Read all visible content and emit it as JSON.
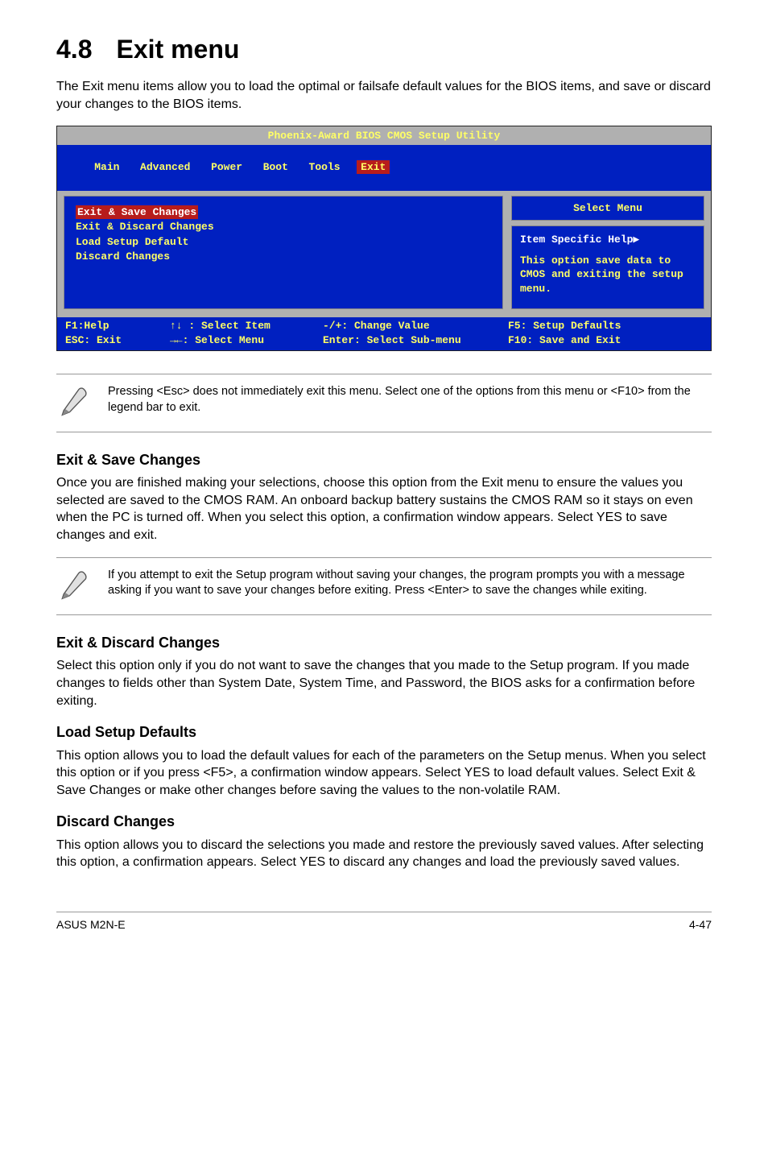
{
  "title_num": "4.8",
  "title_text": "Exit menu",
  "intro": "The Exit menu items allow you to load the optimal or failsafe default values for the BIOS items, and save or discard your changes to the BIOS items.",
  "bios": {
    "top": "Phoenix-Award BIOS CMOS Setup Utility",
    "tabs": [
      "Main",
      "Advanced",
      "Power",
      "Boot",
      "Tools",
      "Exit"
    ],
    "tabs_selected_index": 5,
    "items": [
      "Exit & Save Changes",
      "Exit & Discard Changes",
      "Load Setup Default",
      "Discard Changes"
    ],
    "highlight_index": 0,
    "right_title": "Select Menu",
    "help_label": "Item Specific Help▶",
    "help_body": "This option save data to CMOS and exiting the setup menu.",
    "foot_f1": "F1:Help",
    "foot_esc": "ESC: Exit",
    "foot_selitem": "↑↓ : Select Item",
    "foot_selmenu": "→←: Select Menu",
    "foot_change": "-/+: Change Value",
    "foot_enter": "Enter: Select Sub-menu",
    "foot_f5": "F5: Setup Defaults",
    "foot_f10": "F10: Save and Exit"
  },
  "note1": "Pressing <Esc> does not immediately exit this menu. Select one of the options from this menu or <F10> from the legend bar to exit.",
  "sections": {
    "esc_title": "Exit & Save Changes",
    "esc_body": "Once you are finished making your selections, choose this option from the Exit menu to ensure the values you selected are saved to the CMOS RAM. An onboard backup battery sustains the CMOS RAM so it stays on even when the PC is turned off. When you select this option, a confirmation window appears. Select YES to save changes and exit.",
    "note2": " If you attempt to exit the Setup program without saving your changes, the program prompts you with a message asking if you want to save your changes before exiting. Press <Enter>  to save the  changes while exiting.",
    "edc_title": "Exit & Discard Changes",
    "edc_body": "Select this option only if you do not want to save the changes that you  made to the Setup program. If you made changes to fields other than System Date, System Time, and Password, the BIOS asks for a confirmation before exiting.",
    "lsd_title": "Load Setup Defaults",
    "lsd_body": "This option allows you to load the default values for each of the parameters on the Setup menus. When you select this option or if you press <F5>, a confirmation window appears. Select YES to load default values. Select Exit & Save Changes or make other changes before saving the values to the non-volatile RAM.",
    "dc_title": "Discard Changes",
    "dc_body": "This option allows you to discard the selections you made and restore the previously saved values. After selecting this option, a confirmation appears. Select YES to discard any changes and load the previously saved values."
  },
  "footer_left": "ASUS M2N-E",
  "footer_right": "4-47"
}
